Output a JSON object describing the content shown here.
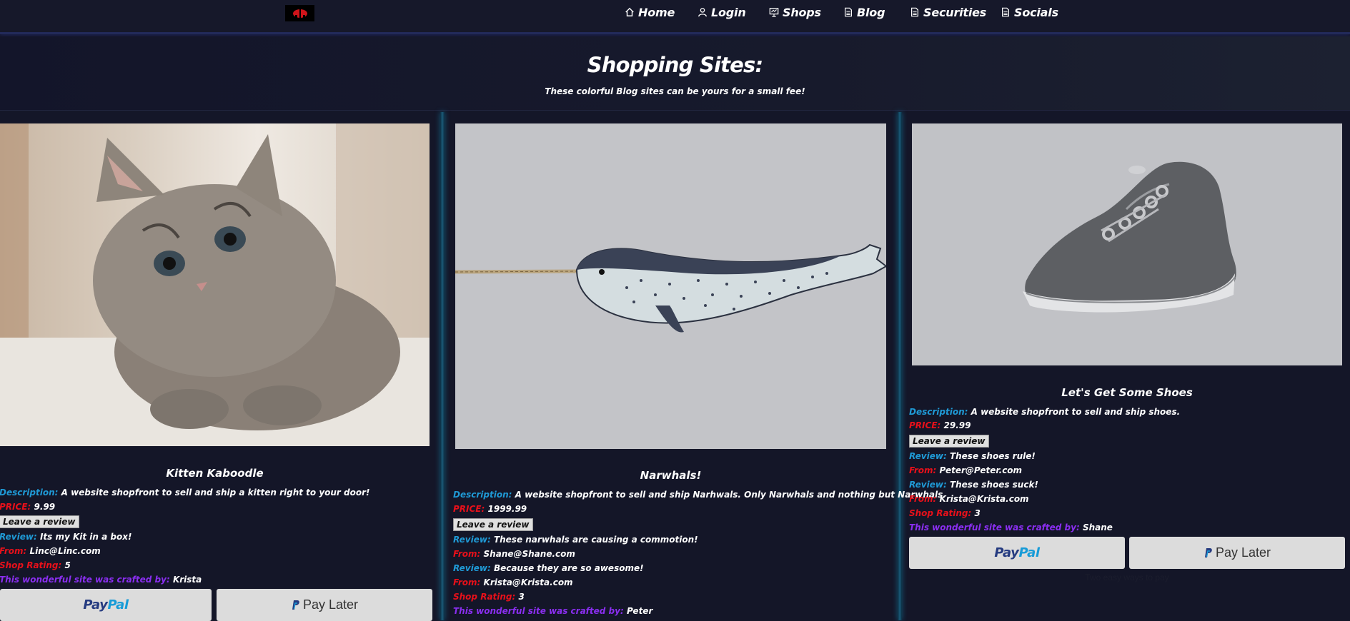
{
  "nav": {
    "items": [
      {
        "label": "Home",
        "icon": "home-icon"
      },
      {
        "label": "Login",
        "icon": "user-icon"
      },
      {
        "label": "Shops",
        "icon": "presentation-icon"
      },
      {
        "label": "Blog",
        "icon": "document-icon"
      },
      {
        "label": "Securities",
        "icon": "document-icon"
      },
      {
        "label": "Socials",
        "icon": "document-icon"
      }
    ]
  },
  "hero": {
    "title": "Shopping Sites:",
    "subtitle": "These colorful Blog sites can be yours for a small fee!"
  },
  "labels": {
    "description": "Description:",
    "price": "PRICE:",
    "review": "Review:",
    "from": "From:",
    "rating": "Shop Rating:",
    "crafted": "This wonderful site was crafted by:",
    "leave_review": "Leave a review",
    "paypal_pay": "Pay",
    "paypal_pal": "Pal",
    "pay_later": "Pay Later",
    "pay_caption": "Two easy ways to pay"
  },
  "shops": [
    {
      "title": "Kitten Kaboodle",
      "image": "kitten-photo",
      "description": "A website shopfront to sell and ship a kitten right to your door!",
      "price": "9.99",
      "reviews": [
        {
          "text": "Its my Kit in a box!",
          "from": "Linc@Linc.com"
        }
      ],
      "rating": "5",
      "crafted_by": "Krista"
    },
    {
      "title": "Narwhals!",
      "image": "narwhal-illustration",
      "description": "A website shopfront to sell and ship Narhwals. Only Narwhals and nothing but Narwhals.",
      "price": "1999.99",
      "reviews": [
        {
          "text": "These narwhals are causing a commotion!",
          "from": "Shane@Shane.com"
        },
        {
          "text": "Because they are so awesome!",
          "from": "Krista@Krista.com"
        }
      ],
      "rating": "3",
      "crafted_by": "Peter"
    },
    {
      "title": "Let's Get Some Shoes",
      "image": "sneaker-photo",
      "description": "A website shopfront to sell and ship shoes.",
      "price": "29.99",
      "reviews": [
        {
          "text": "These shoes rule!",
          "from": "Peter@Peter.com"
        },
        {
          "text": "These shoes suck!",
          "from": "Krista@Krista.com"
        }
      ],
      "rating": "3",
      "crafted_by": "Shane"
    }
  ],
  "colors": {
    "page_bg": "#141628",
    "label_blue": "#1f9ad6",
    "label_red": "#e8101a",
    "label_purple": "#8a2ef0",
    "divider_glow": "#145a7a"
  }
}
